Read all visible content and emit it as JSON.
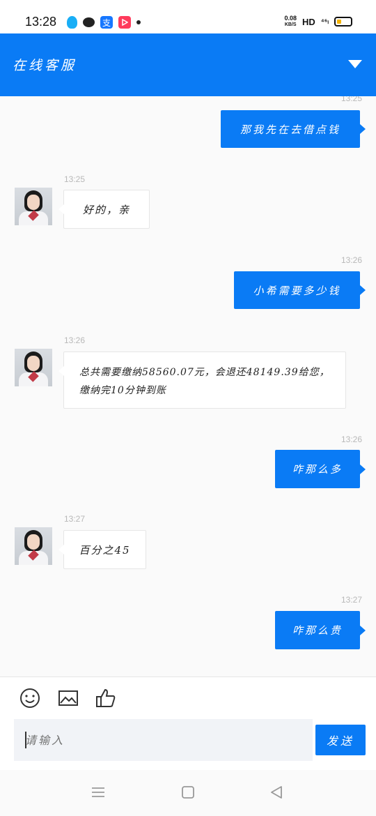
{
  "status_bar": {
    "time": "13:28",
    "net_speed_value": "0.08",
    "net_speed_unit": "KB/S",
    "hd": "HD",
    "signal": "⁴⁶ₗ",
    "battery_level": 0.35,
    "alipay_glyph": "支"
  },
  "header": {
    "title": "在线客服"
  },
  "messages": [
    {
      "side": "right",
      "time": "13:25",
      "text": "那我先在去借点钱"
    },
    {
      "side": "left",
      "time": "13:25",
      "text": "好的，亲"
    },
    {
      "side": "right",
      "time": "13:26",
      "text": "小希需要多少钱"
    },
    {
      "side": "left",
      "time": "13:26",
      "text": "总共需要缴纳58560.07元，会退还48149.39给您，缴纳完10分钟到账"
    },
    {
      "side": "right",
      "time": "13:26",
      "text": "咋那么多"
    },
    {
      "side": "left",
      "time": "13:27",
      "text": "百分之45"
    },
    {
      "side": "right",
      "time": "13:27",
      "text": "咋那么贵"
    }
  ],
  "composer": {
    "placeholder": "请输入",
    "send_label": "发送"
  },
  "colors": {
    "accent": "#0a7bf5"
  }
}
